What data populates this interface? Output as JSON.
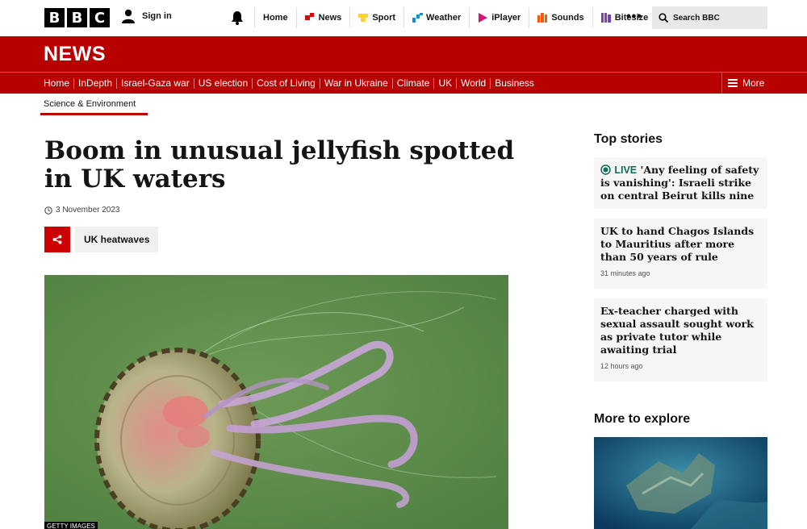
{
  "header": {
    "logo_letters": [
      "B",
      "B",
      "C"
    ],
    "signin_label": "Sign in",
    "nav": [
      {
        "label": "Home",
        "icon": "home",
        "color": ""
      },
      {
        "label": "News",
        "icon": "news-icon",
        "color": "#d20a0a"
      },
      {
        "label": "Sport",
        "icon": "sport-icon",
        "color": "#ffd230"
      },
      {
        "label": "Weather",
        "icon": "weather-icon",
        "color": "#1a8ad4"
      },
      {
        "label": "iPlayer",
        "icon": "iplayer-icon",
        "color": "#d7117d"
      },
      {
        "label": "Sounds",
        "icon": "sounds-icon",
        "color": "#f55a08"
      },
      {
        "label": "Bitesize",
        "icon": "bitesize-icon",
        "color": "#7b3dbb"
      }
    ],
    "more_dots": "•••",
    "search_label": "Search BBC"
  },
  "news_banner": {
    "wordmark": "NEWS",
    "subnav": [
      "Home",
      "InDepth",
      "Israel-Gaza war",
      "US election",
      "Cost of Living",
      "War in Ukraine",
      "Climate",
      "UK",
      "World",
      "Business"
    ],
    "more_label": "More"
  },
  "section": {
    "label": "Science & Environment"
  },
  "article": {
    "headline": "Boom in unusual jellyfish spotted in UK waters",
    "date": "3 November 2023",
    "tag": "UK heatwaves",
    "image_credit": "GETTY IMAGES"
  },
  "sidebar": {
    "top_stories_title": "Top stories",
    "stories": [
      {
        "live": "LIVE",
        "headline": "'Any feeling of safety is vanishing': Israeli strike on central Beirut kills nine",
        "time": ""
      },
      {
        "live": "",
        "headline": "UK to hand Chagos Islands to Mauritius after more than 50 years of rule",
        "time": "31 minutes ago"
      },
      {
        "live": "",
        "headline": "Ex-teacher charged with sexual assault sought work as private tutor while awaiting trial",
        "time": "12 hours ago"
      }
    ],
    "explore_title": "More to explore"
  },
  "colors": {
    "brand_red": "#b80000",
    "live_green": "#0b6e57"
  }
}
